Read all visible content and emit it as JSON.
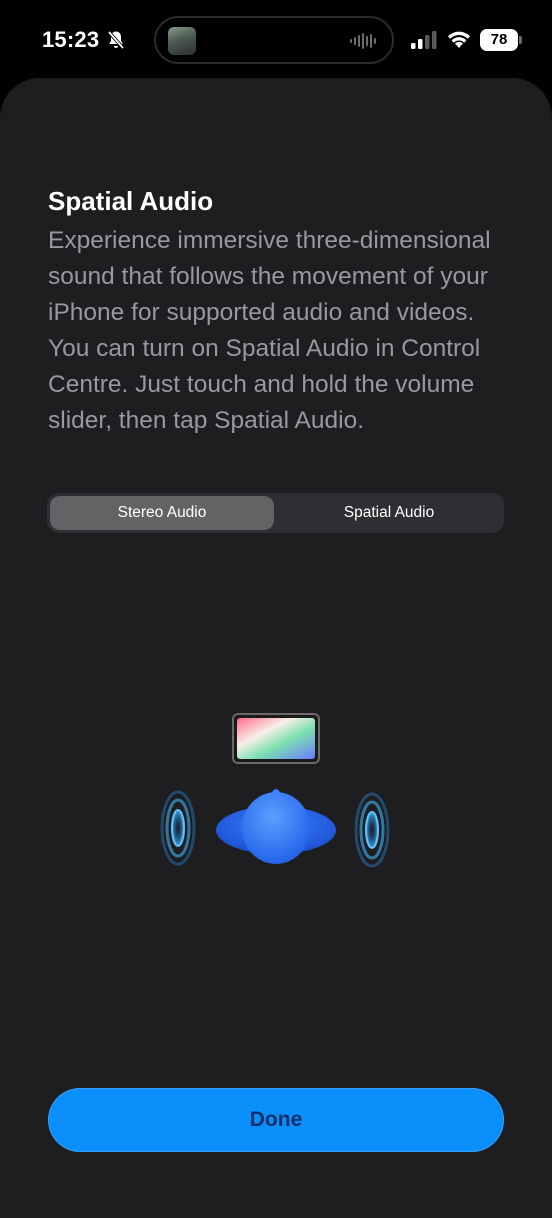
{
  "status_bar": {
    "time": "15:23",
    "battery": "78",
    "icons": [
      "bell-slash-icon",
      "waveform-icon",
      "cellular-signal-icon",
      "wifi-icon",
      "battery-icon"
    ]
  },
  "sheet": {
    "title": "Spatial Audio",
    "description": "Experience immersive three-dimensional sound that follows the movement of your iPhone for supported audio and videos. You can turn on Spatial Audio in Control Centre. Just touch and hold the volume slider, then tap Spatial Audio.",
    "segments": [
      {
        "label": "Stereo Audio",
        "selected": true
      },
      {
        "label": "Spatial Audio",
        "selected": false
      }
    ],
    "done_label": "Done"
  },
  "colors": {
    "sheet_background": "#1e1e20",
    "accent": "#0a8ffb",
    "secondary_text": "#98989e"
  }
}
